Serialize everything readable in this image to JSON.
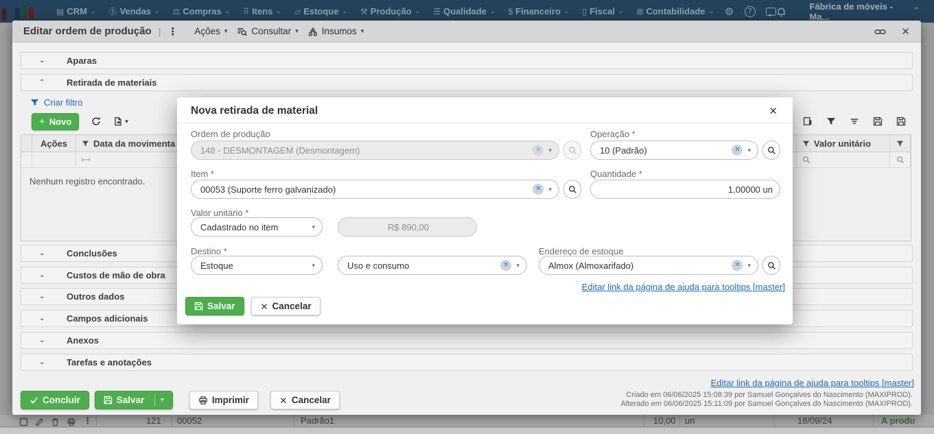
{
  "topbar": {
    "menus": [
      {
        "label": "CRM"
      },
      {
        "label": "Vendas"
      },
      {
        "label": "Compras"
      },
      {
        "label": "Itens"
      },
      {
        "label": "Estoque"
      },
      {
        "label": "Produção"
      },
      {
        "label": "Qualidade"
      },
      {
        "label": "Financeiro"
      },
      {
        "label": "Fiscal"
      },
      {
        "label": "Contabilidade"
      }
    ],
    "account_label": "Fábrica de móveis - Ma..."
  },
  "window": {
    "title": "Editar ordem de produção",
    "toolbar": {
      "acoes": "Ações",
      "consultar": "Consultar",
      "insumos": "Insumos"
    },
    "sections": {
      "aparas": "Aparas",
      "retirada": "Retirada de materiais",
      "conclusoes": "Conclusões",
      "custos": "Custos de mão de obra",
      "outros": "Outros dados",
      "campos": "Campos adicionais",
      "anexos": "Anexos",
      "tarefas": "Tarefas e anotações"
    },
    "grid": {
      "criar_filtro": "Criar filtro",
      "novo": "Novo",
      "col_acoes": "Ações",
      "col_data": "Data da movimenta",
      "col_valor_unitario": "Valor unitário",
      "empty": "Nenhum registro encontrado."
    },
    "footer": {
      "help_link": "Editar link da página de ajuda para tooltips [master]",
      "created": "Criado em 06/06/2025 15:08:39 por Samuel Gonçalves do Nascimento (MAXIPROD).",
      "altered": "Alterado em 06/06/2025 15:11:09 por Samuel Gonçalves do Nascimento (MAXIPROD).",
      "concluir": "Concluir",
      "salvar": "Salvar",
      "imprimir": "Imprimir",
      "cancelar": "Cancelar"
    }
  },
  "modal": {
    "title": "Nova retirada de material",
    "fields": {
      "ordem_label": "Ordem de produção",
      "ordem_value": "148 - DESMONTAGEM (Desmontagem)",
      "operacao_label": "Operação *",
      "operacao_value": "10 (Padrão)",
      "item_label": "Item *",
      "item_value": "00053 (Suporte ferro galvanizado)",
      "quantidade_label": "Quantidade *",
      "quantidade_value": "1,00000 un",
      "valor_label": "Valor unitário *",
      "valor_mode": "Cadastrado no item",
      "valor_value": "R$ 890,00",
      "destino_label": "Destino *",
      "destino_value": "Estoque",
      "destino_tipo": "Uso e consumo",
      "endereco_label": "Endereço de estoque",
      "endereco_value": "Almox (Almoxarifado)"
    },
    "help_link": "Editar link da página de ajuda para tooltips [master]",
    "salvar": "Salvar",
    "cancelar": "Cancelar"
  },
  "background_row": {
    "id": "121",
    "code": "00052",
    "name": "Padrão1",
    "qty": "10,00",
    "unit": "un",
    "date": "18/09/24",
    "status": "A produ"
  },
  "colors": {
    "green": "#4cae4c",
    "link": "#1a6bbf",
    "topbar": "#25425c"
  }
}
